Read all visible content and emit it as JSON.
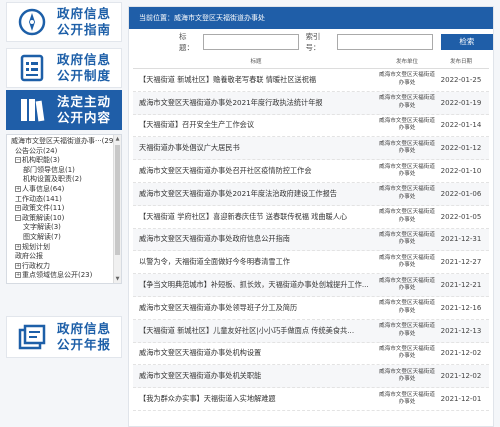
{
  "nav": [
    {
      "line1": "政府信息",
      "line2": "公开指南",
      "icon": "compass-icon"
    },
    {
      "line1": "政府信息",
      "line2": "公开制度",
      "icon": "document-list-icon"
    },
    {
      "line1": "法定主动",
      "line2": "公开内容",
      "icon": "books-icon"
    },
    {
      "line1": "政府信息",
      "line2": "公开年报",
      "icon": "report-icon"
    }
  ],
  "tree": [
    {
      "text": "威海市文登区天福街道办事···(29",
      "level": 1,
      "pm": ""
    },
    {
      "text": "公告公示(24)",
      "level": 2,
      "pm": ""
    },
    {
      "text": "机构职能(3)",
      "level": 2,
      "pm": "−"
    },
    {
      "text": "部门领导信息(1)",
      "level": 3,
      "pm": ""
    },
    {
      "text": "机构设置及职责(2)",
      "level": 3,
      "pm": ""
    },
    {
      "text": "人事信息(64)",
      "level": 2,
      "pm": "+"
    },
    {
      "text": "工作动态(141)",
      "level": 2,
      "pm": ""
    },
    {
      "text": "政策文件(11)",
      "level": 2,
      "pm": "+"
    },
    {
      "text": "政策解读(10)",
      "level": 2,
      "pm": "−"
    },
    {
      "text": "文字解读(3)",
      "level": 3,
      "pm": ""
    },
    {
      "text": "图文解读(7)",
      "level": 3,
      "pm": ""
    },
    {
      "text": "规划计划",
      "level": 2,
      "pm": "+"
    },
    {
      "text": "政府公报",
      "level": 2,
      "pm": ""
    },
    {
      "text": "行政权力",
      "level": 2,
      "pm": "+"
    },
    {
      "text": "重点领域信息公开(23)",
      "level": 2,
      "pm": "+"
    }
  ],
  "breadcrumb": "当前位置：威海市文登区天福街道办事处",
  "search": {
    "title_label": "标题：",
    "index_label": "索引号：",
    "button": "检索"
  },
  "columns": {
    "title": "标题",
    "unit": "发布单位",
    "date": "发布日期"
  },
  "rows": [
    {
      "title": "【天福街道 新城社区】赡養敬老写春联 情暖社区送祝福",
      "unit": "威海市文登区天福街道办事处",
      "date": "2022-01-25"
    },
    {
      "title": "威海市文登区天福街道办事处2021年度行政执法统计年报",
      "unit": "威海市文登区天福街道办事处",
      "date": "2022-01-19"
    },
    {
      "title": "【天福街道】召开安全生产工作会议",
      "unit": "威海市文登区天福街道办事处",
      "date": "2022-01-14"
    },
    {
      "title": "天福街道办事处倡议广大居民书",
      "unit": "威海市文登区天福街道办事处",
      "date": "2022-01-12"
    },
    {
      "title": "威海市文登区天福街道办事处召开社区疫情防控工作会",
      "unit": "威海市文登区天福街道办事处",
      "date": "2022-01-10"
    },
    {
      "title": "威海市文登区天福街道办事处2021年度法治政府建设工作报告",
      "unit": "威海市文登区天福街道办事处",
      "date": "2022-01-06"
    },
    {
      "title": "【天福街道 学府社区】喜迎新春庆佳节 送春联传祝福 戏曲暖人心",
      "unit": "威海市文登区天福街道办事处",
      "date": "2022-01-05"
    },
    {
      "title": "威海市文登区天福街道办事处政府信息公开指南",
      "unit": "威海市文登区天福街道办事处",
      "date": "2021-12-31"
    },
    {
      "title": "以警为令，天福街道全面做好今冬明春清雪工作",
      "unit": "威海市文登区天福街道办事处",
      "date": "2021-12-27"
    },
    {
      "title": "【争当文明典范城市】补短板、抓长效，天福街道办事处创城提升工作...",
      "unit": "威海市文登区天福街道办事处",
      "date": "2021-12-21"
    },
    {
      "title": "威海市文登区天福街道办事处领导班子分工及简历",
      "unit": "威海市文登区天福街道办事处",
      "date": "2021-12-16"
    },
    {
      "title": "【天福街道 新城社区】儿童友好社区|小小巧手做面点 传统美食共...",
      "unit": "威海市文登区天福街道办事处",
      "date": "2021-12-13"
    },
    {
      "title": "威海市文登区天福街道办事处机构设置",
      "unit": "威海市文登区天福街道办事处",
      "date": "2021-12-02"
    },
    {
      "title": "威海市文登区天福街道办事处机关职能",
      "unit": "威海市文登区天福街道办事处",
      "date": "2021-12-02"
    },
    {
      "title": "【我为群众办实事】天福街道入实地解难题",
      "unit": "威海市文登区天福街道办事处",
      "date": "2021-12-01"
    }
  ]
}
